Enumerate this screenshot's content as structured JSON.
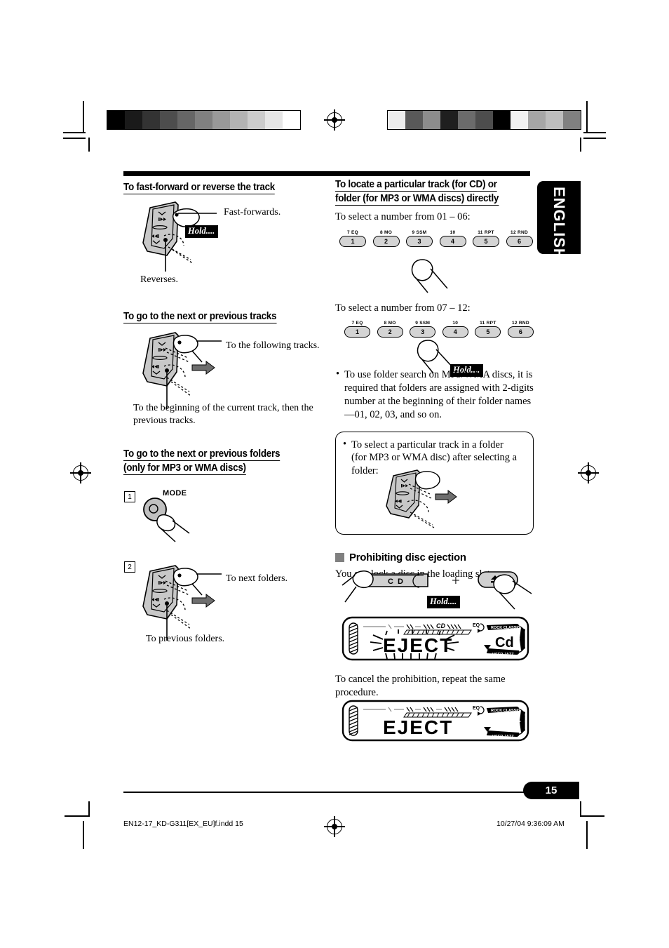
{
  "page": {
    "language_tab": "ENGLISH",
    "number": "15",
    "footer_left": "EN12-17_KD-G311[EX_EU]f.indd   15",
    "footer_right": "10/27/04   9:36:09 AM"
  },
  "left_column": {
    "section1": {
      "heading": "To fast-forward or reverse the track",
      "callout_forward": "Fast-forwards.",
      "callout_reverse": "Reverses.",
      "hold_badge": "Hold...."
    },
    "section2": {
      "heading": "To go to the next or previous tracks",
      "callout_next": "To the following tracks.",
      "callout_prev": "To the beginning of the current track, then the previous tracks."
    },
    "section3": {
      "heading_line1": "To go to the next or previous folders",
      "heading_line2": "(only for MP3 or WMA discs)",
      "step1_number": "1",
      "step1_label": "MODE",
      "step2_number": "2",
      "callout_next": "To next folders.",
      "callout_prev": "To previous folders."
    }
  },
  "right_column": {
    "section1": {
      "heading_line1": "To locate a particular track (for CD) or",
      "heading_line2": "folder (for MP3 or WMA discs) directly",
      "intro_01_06": "To select a number from 01 – 06:",
      "intro_07_12": "To select a number from 07 – 12:",
      "hold_badge": "Hold....",
      "bullet": "To use folder search on MP3/WMA discs, it is required that folders are assigned with 2-digits number at the beginning of their folder names—01, 02, 03, and so on.",
      "note_bullet_line1": "To select a particular track in a folder",
      "note_bullet_line2": "(for MP3 or WMA disc) after selecting a",
      "note_bullet_line3": "folder:"
    },
    "number_buttons": [
      {
        "top": "7  EQ",
        "key": "1"
      },
      {
        "top": "8  MO",
        "key": "2"
      },
      {
        "top": "9  SSM",
        "key": "3"
      },
      {
        "top": "10",
        "key": "4"
      },
      {
        "top": "11  RPT",
        "key": "5"
      },
      {
        "top": "12  RND",
        "key": "6"
      }
    ],
    "section2": {
      "heading": "Prohibiting disc ejection",
      "body": "You can lock a disc in the loading slot.",
      "cd_button_label": "C  D",
      "plus_sign": "+",
      "hold_badge": "Hold....",
      "eject_icon": "eject-icon",
      "cancel_text": "To cancel the prohibition, repeat the same procedure."
    },
    "display1": {
      "main_text": "EJECT",
      "side_text": "Cd",
      "indicator_eq": "EQ",
      "arc_top": "ROCK  CLASSIC",
      "arc_bottom": "USER  JAZZ",
      "arc_right": "POPS"
    },
    "display2": {
      "main_text": "EJECT",
      "indicator_eq": "EQ",
      "arc_top": "ROCK  CLASSIC",
      "arc_bottom": "USER  JAZZ",
      "arc_right": "POPS"
    }
  },
  "registration": {
    "gray_bar_left": [
      "#000000",
      "#1a1a1a",
      "#333333",
      "#4d4d4d",
      "#666666",
      "#808080",
      "#999999",
      "#b3b3b3",
      "#cccccc",
      "#e6e6e6",
      "#ffffff"
    ],
    "gray_bar_right": [
      "#ededed",
      "#595959",
      "#8c8c8c",
      "#1f1f1f",
      "#6b6b6b",
      "#4d4d4d",
      "#000000",
      "#f2f2f2",
      "#a6a6a6",
      "#bdbdbd",
      "#808080"
    ]
  }
}
